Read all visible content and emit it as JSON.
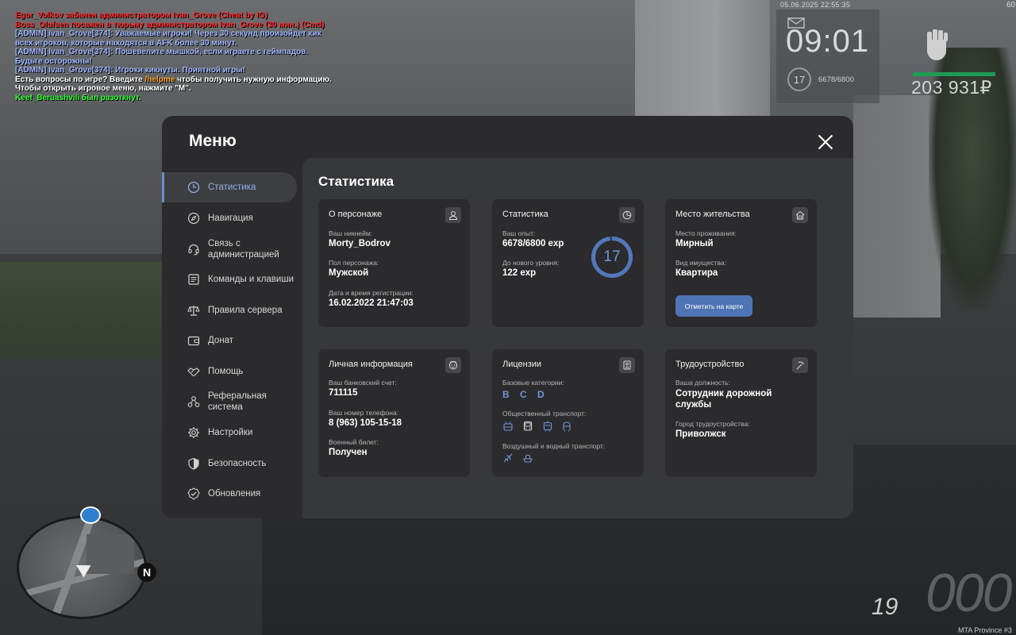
{
  "chat": [
    {
      "text": "Egor_Volkov забанен администратором Ivan_Grove (Cheat by IG)",
      "color": "red"
    },
    {
      "text": "Boss_Olufsen посажен в тюрьму администратором Ivan_Grove (30 мин.) (Cmd)",
      "color": "red"
    },
    {
      "text": "[ADMIN] Ivan_Grove[374]: Уважаемые игроки! Через 30 секунд произойдет кик",
      "color": "blue"
    },
    {
      "text": " всех игроков, которые находятся в AFK более 30 минут.",
      "color": "blue"
    },
    {
      "text": "[ADMIN] Ivan_Grove[374]: Пошевелите мышкой, если играете с геймпадов.",
      "color": "blue"
    },
    {
      "text": " Будьте осторожны!",
      "color": "blue"
    },
    {
      "text": "[ADMIN] Ivan_Grove[374]: Игроки кикнуты. Приятной игры!",
      "color": "blue"
    },
    {
      "text_a": "Есть вопросы по игре? Введите ",
      "text_cmd": "/helpme",
      "text_b": " чтобы получить нужную информацию.",
      "color": "white"
    },
    {
      "text": "Чтобы открыть игровое меню, нажмите \"M\".",
      "color": "white"
    },
    {
      "text": "Keef_Beruashvili был разоткнут.",
      "color": "green"
    }
  ],
  "hud": {
    "date": "05.06.2025 22:55:35",
    "fps": "60",
    "clock": "09:01",
    "level": "17",
    "exp": "6678/6800",
    "money": "203 931₽",
    "money_bar_color": "#1f9b53",
    "speed": "19",
    "speed_big": "000",
    "server": "MTA Province #3",
    "north": "N"
  },
  "menu": {
    "title": "Меню",
    "close_icon": "close-icon",
    "accent": "#6a8fd0",
    "nav": [
      {
        "label": "Статистика",
        "icon": "clock-icon",
        "active": true
      },
      {
        "label": "Навигация",
        "icon": "compass-icon",
        "active": false
      },
      {
        "label": "Связь с\nадминистрацией",
        "icon": "headset-icon",
        "active": false
      },
      {
        "label": "Команды и клавиши",
        "icon": "list-icon",
        "active": false
      },
      {
        "label": "Правила сервера",
        "icon": "scales-icon",
        "active": false
      },
      {
        "label": "Донат",
        "icon": "wallet-icon",
        "active": false
      },
      {
        "label": "Помощь",
        "icon": "handshake-icon",
        "active": false
      },
      {
        "label": "Реферальная\nсистема",
        "icon": "network-icon",
        "active": false
      },
      {
        "label": "Настройки",
        "icon": "gear-icon",
        "active": false
      },
      {
        "label": "Безопасность",
        "icon": "shield-icon",
        "active": false
      },
      {
        "label": "Обновления",
        "icon": "check-badge-icon",
        "active": false
      }
    ]
  },
  "stats": {
    "title": "Статистика",
    "about": {
      "title": "О персонаже",
      "icon": "user-icon",
      "nick_label": "Ваш никнейм:",
      "nick": "Morty_Bodrov",
      "gender_label": "Пол персонажа:",
      "gender": "Мужской",
      "reg_label": "Дата и время регистрации:",
      "reg": "16.02.2022 21:47:03"
    },
    "statistics": {
      "title": "Статистика",
      "icon": "chart-icon",
      "exp_label": "Ваш опыт:",
      "exp": "6678/6800 exp",
      "next_label": "До нового уровня:",
      "next": "122 exp",
      "level": "17",
      "progress": 0.982
    },
    "residence": {
      "title": "Место жительства",
      "icon": "house-icon",
      "place_label": "Место проживания:",
      "place": "Мирный",
      "type_label": "Вид имущества:",
      "type": "Квартира",
      "button": "Отметить на карте"
    },
    "personal": {
      "title": "Личная информация",
      "icon": "face-icon",
      "bank_label": "Ваш банковский счет:",
      "bank": "711115",
      "phone_label": "Ваш номер телефона:",
      "phone": "8 (963) 105-15-18",
      "military_label": "Военный билет:",
      "military": "Получен"
    },
    "licenses": {
      "title": "Лицензии",
      "icon": "id-card-icon",
      "base_label": "Базовые категории:",
      "base": "B C D",
      "public_label": "Общественный транспорт:",
      "public_icons": [
        "trolleybus-icon",
        "bus-icon",
        "tram-icon",
        "metro-icon"
      ],
      "air_label": "Воздушный и водный транспорт:",
      "air_icons": [
        "plane-icon",
        "boat-icon"
      ]
    },
    "employment": {
      "title": "Трудоустройство",
      "icon": "pickaxe-icon",
      "job_label": "Ваша должность:",
      "job": "Сотрудник дорожной\nслужбы",
      "city_label": "Город трудоустройства:",
      "city": "Приволжск"
    }
  }
}
